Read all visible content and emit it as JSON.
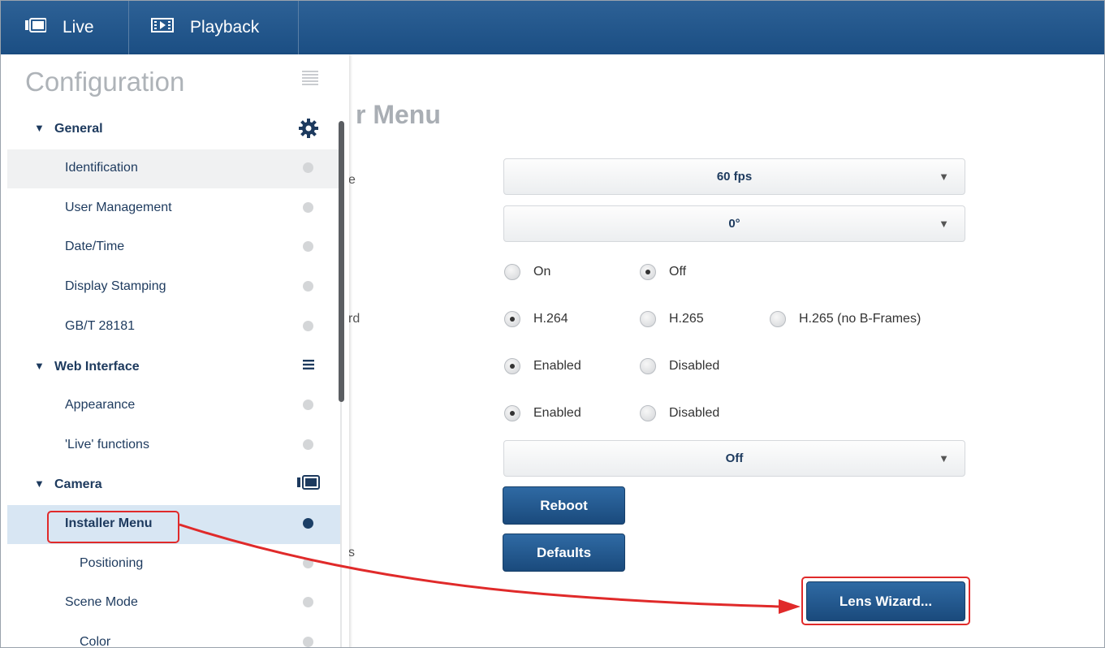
{
  "topbar": {
    "tabs": [
      {
        "label": "Live",
        "icon": "camera-icon"
      },
      {
        "label": "Playback",
        "icon": "playback-icon"
      }
    ]
  },
  "sidebar": {
    "title": "Configuration",
    "sections": [
      {
        "label": "General",
        "icon": "gear-icon",
        "items": [
          "Identification",
          "User Management",
          "Date/Time",
          "Display Stamping",
          "GB/T 28181"
        ]
      },
      {
        "label": "Web Interface",
        "icon": "menu-icon",
        "items": [
          "Appearance",
          "'Live' functions"
        ]
      },
      {
        "label": "Camera",
        "icon": "camera-icon",
        "items": [
          "Installer Menu",
          "Positioning",
          "Scene Mode",
          "Color"
        ]
      }
    ],
    "active_item": "Installer Menu"
  },
  "main": {
    "title": "r Menu",
    "label_fragments": [
      "e",
      "rd",
      "s"
    ],
    "frame_rate": {
      "value": "60 fps"
    },
    "rotation": {
      "value": "0°"
    },
    "mirror": {
      "options": [
        "On",
        "Off"
      ],
      "selected": "Off"
    },
    "coding_standard": {
      "options": [
        "H.264",
        "H.265",
        "H.265 (no B-Frames)"
      ],
      "selected": "H.264"
    },
    "setting_a": {
      "options": [
        "Enabled",
        "Disabled"
      ],
      "selected": "Enabled"
    },
    "setting_b": {
      "options": [
        "Enabled",
        "Disabled"
      ],
      "selected": "Enabled"
    },
    "dropdown_3": {
      "value": "Off"
    },
    "reboot_label": "Reboot",
    "defaults_label": "Defaults",
    "lens_wizard_label": "Lens Wizard..."
  },
  "colors": {
    "header": "#1b4e83",
    "accent_red": "#e02a2a",
    "active_row": "#d8e6f3"
  }
}
